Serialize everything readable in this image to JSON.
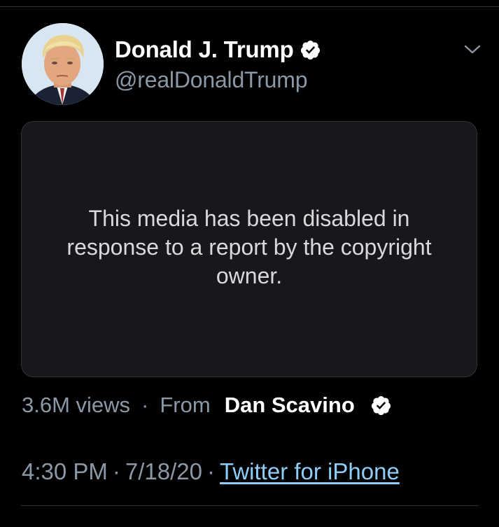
{
  "tweet": {
    "author": {
      "display_name": "Donald J. Trump",
      "handle": "@realDonaldTrump",
      "verified_icon": "verified-badge-icon",
      "avatar": "profile-photo"
    },
    "menu_icon": "chevron-down-icon",
    "media": {
      "notice": "This media has been disabled in response to a report by the copyright owner."
    },
    "meta": {
      "views": "3.6M views",
      "separator": "·",
      "from_label": "From",
      "source_name": "Dan Scavino",
      "source_verified_icon": "verified-badge-icon"
    },
    "timestamp": {
      "time": "4:30 PM",
      "separator": "·",
      "date": "7/18/20",
      "separator2": "·",
      "client": "Twitter for iPhone"
    }
  },
  "colors": {
    "background": "#000000",
    "secondary_text": "#8b98a5",
    "link": "#8ecdf8",
    "media_box": "#16181c",
    "divider": "#2f3336"
  }
}
